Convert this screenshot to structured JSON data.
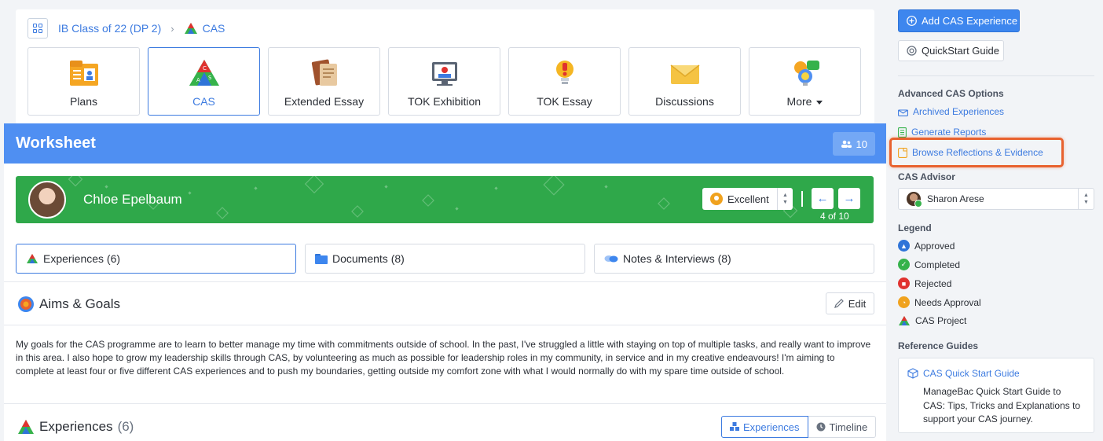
{
  "breadcrumb": {
    "class_name": "IB Class of 22 (DP 2)",
    "current": "CAS"
  },
  "tiles": [
    {
      "label": "Plans",
      "icon": "plans-icon"
    },
    {
      "label": "CAS",
      "icon": "cas-icon"
    },
    {
      "label": "Extended Essay",
      "icon": "extended-essay-icon"
    },
    {
      "label": "TOK Exhibition",
      "icon": "tok-exhibition-icon"
    },
    {
      "label": "TOK Essay",
      "icon": "tok-essay-icon"
    },
    {
      "label": "Discussions",
      "icon": "discussions-icon"
    },
    {
      "label": "More",
      "icon": "more-icon"
    }
  ],
  "worksheet": {
    "title": "Worksheet",
    "student_count": "10",
    "student": {
      "name": "Chloe Epelbaum",
      "grade": "Excellent",
      "position": "4 of 10"
    },
    "tabs": [
      {
        "label": "Experiences (6)"
      },
      {
        "label": "Documents (8)"
      },
      {
        "label": "Notes & Interviews (8)"
      }
    ],
    "aims": {
      "title": "Aims & Goals",
      "edit_label": "Edit",
      "text": "My goals for the CAS programme are to learn to better manage my time with commitments outside of school. In the past, I've struggled a little with staying on top of multiple tasks, and really want to improve in this area. I also hope to grow my leadership skills through CAS, by volunteering as much as possible for leadership roles in my community, in service and in my creative endeavours! I'm aiming to complete at least four or five different CAS experiences and to push my boundaries, getting outside my comfort zone with what I would normally do with my spare time outside of school."
    },
    "experiences": {
      "title": "Experiences",
      "count": "(6)",
      "view_experiences": "Experiences",
      "view_timeline": "Timeline"
    }
  },
  "sidebar": {
    "add_button": "Add CAS Experience",
    "quickstart_button": "QuickStart Guide",
    "advanced_heading": "Advanced CAS Options",
    "links": [
      {
        "label": "Archived Experiences"
      },
      {
        "label": "Generate Reports"
      },
      {
        "label": "Browse Reflections & Evidence"
      }
    ],
    "advisor_heading": "CAS Advisor",
    "advisor_name": "Sharon Arese",
    "legend_heading": "Legend",
    "legend": [
      {
        "label": "Approved",
        "color": "#2f74d8"
      },
      {
        "label": "Completed",
        "color": "#36b24b"
      },
      {
        "label": "Rejected",
        "color": "#e0322f"
      },
      {
        "label": "Needs Approval",
        "color": "#f0a21e"
      },
      {
        "label": "CAS Project",
        "color": "#cas"
      }
    ],
    "reference_heading": "Reference Guides",
    "guide": {
      "title": "CAS Quick Start Guide",
      "description": "ManageBac Quick Start Guide to CAS: Tips, Tricks and Explanations to support your CAS journey."
    }
  },
  "colors": {
    "accent": "#3d7be0",
    "header": "#4f8ff2",
    "student_bar": "#2fa84a",
    "highlight": "#e8622f"
  }
}
